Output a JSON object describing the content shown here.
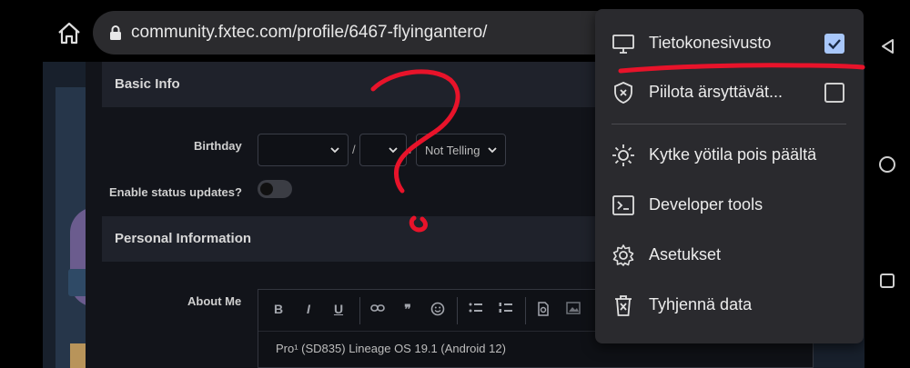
{
  "browser": {
    "url": "community.fxtec.com/profile/6467-flyingantero/"
  },
  "profile_form": {
    "basic_info": {
      "heading": "Basic Info"
    },
    "birthday": {
      "label": "Birthday",
      "month_value": "",
      "day_value": "",
      "year_value": "Not Telling",
      "separator": "/"
    },
    "status_updates": {
      "label": "Enable status updates?",
      "enabled": false
    },
    "personal_info": {
      "heading": "Personal Information"
    },
    "about_me": {
      "label": "About Me",
      "content": "Pro¹ (SD835) Lineage OS 19.1 (Android 12)",
      "toolbar": [
        "B",
        "I",
        "U",
        "link",
        "quote",
        "emoji",
        "bulleted-list",
        "numbered-list",
        "spoiler",
        "image"
      ]
    }
  },
  "menu": {
    "items": [
      {
        "label": "Tietokonesivusto",
        "icon": "desktop-icon",
        "checkbox": true
      },
      {
        "label": "Piilota ärsyttävät...",
        "icon": "shield-x-icon",
        "checkbox": false
      },
      {
        "label": "Kytke yötila pois päältä",
        "icon": "sun-icon"
      },
      {
        "label": "Developer tools",
        "icon": "terminal-icon"
      },
      {
        "label": "Asetukset",
        "icon": "gear-icon"
      },
      {
        "label": "Tyhjennä data",
        "icon": "trash-icon"
      }
    ]
  },
  "colors": {
    "annotation": "#e8132a",
    "checkbox_checked": "#a8c7fa",
    "menu_bg": "#2a2a2e"
  }
}
